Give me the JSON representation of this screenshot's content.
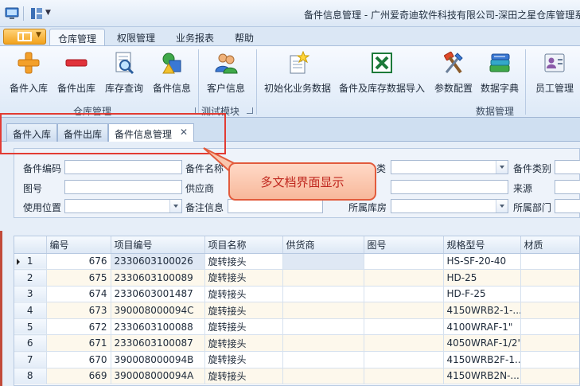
{
  "window": {
    "title": "备件信息管理 - 广州爱奇迪软件科技有限公司-深田之星仓库管理系"
  },
  "ribbon_tabs": [
    {
      "label": "仓库管理",
      "active": true
    },
    {
      "label": "权限管理",
      "active": false
    },
    {
      "label": "业务报表",
      "active": false
    },
    {
      "label": "帮助",
      "active": false
    }
  ],
  "ribbon": {
    "groups": {
      "warehouse": {
        "label": "仓库管理"
      },
      "test": {
        "label": "测试模块"
      },
      "data": {
        "label": "数据管理"
      }
    },
    "buttons": {
      "part_in": "备件入库",
      "part_out": "备件出库",
      "stock_query": "库存查询",
      "part_info": "备件信息",
      "customer_info": "客户信息",
      "init_data": "初始化业务数据",
      "import_data": "备件及库存数据导入",
      "params": "参数配置",
      "dictionary": "数据字典",
      "staff": "员工管理"
    }
  },
  "doc_tabs": [
    {
      "label": "备件入库"
    },
    {
      "label": "备件出库"
    },
    {
      "label": "备件信息管理",
      "active": true
    }
  ],
  "filter": {
    "part_code": "备件编码",
    "part_name": "备件名称",
    "category": "类",
    "part_type": "备件类别",
    "drawing_no": "图号",
    "supplier": "供应商",
    "source": "来源",
    "use_location": "使用位置",
    "remark": "备注信息",
    "warehouse": "所属库房",
    "department": "所属部门"
  },
  "annotation": {
    "callout_text": "多文档界面显示",
    "highlight_color": "#e23b33"
  },
  "grid": {
    "columns": [
      "编号",
      "项目编号",
      "项目名称",
      "供货商",
      "图号",
      "规格型号",
      "材质"
    ],
    "rows": [
      {
        "row": "1",
        "id": "676",
        "project_no": "2330603100026",
        "project_name": "旋转接头",
        "supplier": "",
        "drawing": "",
        "spec": "HS-SF-20-40",
        "material": ""
      },
      {
        "row": "2",
        "id": "675",
        "project_no": "2330603100089",
        "project_name": "旋转接头",
        "supplier": "",
        "drawing": "",
        "spec": "HD-25",
        "material": ""
      },
      {
        "row": "3",
        "id": "674",
        "project_no": "2330603001487",
        "project_name": "旋转接头",
        "supplier": "",
        "drawing": "",
        "spec": "HD-F-25",
        "material": ""
      },
      {
        "row": "4",
        "id": "673",
        "project_no": "390008000094C",
        "project_name": "旋转接头",
        "supplier": "",
        "drawing": "",
        "spec": "4150WRB2-1-...",
        "material": ""
      },
      {
        "row": "5",
        "id": "672",
        "project_no": "2330603100088",
        "project_name": "旋转接头",
        "supplier": "",
        "drawing": "",
        "spec": "4100WRAF-1\"",
        "material": ""
      },
      {
        "row": "6",
        "id": "671",
        "project_no": "2330603100087",
        "project_name": "旋转接头",
        "supplier": "",
        "drawing": "",
        "spec": "4050WRAF-1/2\"",
        "material": ""
      },
      {
        "row": "7",
        "id": "670",
        "project_no": "390008000094B",
        "project_name": "旋转接头",
        "supplier": "",
        "drawing": "",
        "spec": "4150WRB2F-1...",
        "material": ""
      },
      {
        "row": "8",
        "id": "669",
        "project_no": "390008000094A",
        "project_name": "旋转接头",
        "supplier": "",
        "drawing": "",
        "spec": "4150WRB2N-...",
        "material": ""
      }
    ]
  }
}
